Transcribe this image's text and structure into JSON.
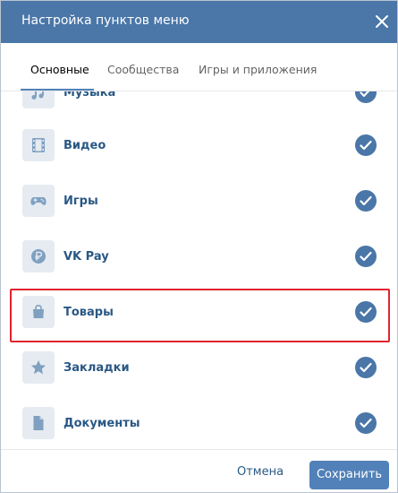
{
  "header": {
    "title": "Настройка пунктов меню",
    "close_icon": "close-icon"
  },
  "tabs": [
    {
      "label": "Основные",
      "active": true
    },
    {
      "label": "Сообщества",
      "active": false
    },
    {
      "label": "Игры и приложения",
      "active": false
    }
  ],
  "items": [
    {
      "label": "Музыка",
      "icon": "music-icon",
      "checked": true
    },
    {
      "label": "Видео",
      "icon": "video-icon",
      "checked": true
    },
    {
      "label": "Игры",
      "icon": "gamepad-icon",
      "checked": true
    },
    {
      "label": "VK Pay",
      "icon": "ruble-coin-icon",
      "checked": true
    },
    {
      "label": "Товары",
      "icon": "shopping-bag-icon",
      "checked": true
    },
    {
      "label": "Закладки",
      "icon": "star-icon",
      "checked": true
    },
    {
      "label": "Документы",
      "icon": "document-icon",
      "checked": true
    }
  ],
  "footer": {
    "cancel_label": "Отмена",
    "save_label": "Сохранить"
  },
  "colors": {
    "header_bg": "#4a76a8",
    "accent": "#5181b8",
    "link": "#2a5885",
    "highlight": "#e0232f",
    "icon_bg": "#e5ebf1"
  }
}
